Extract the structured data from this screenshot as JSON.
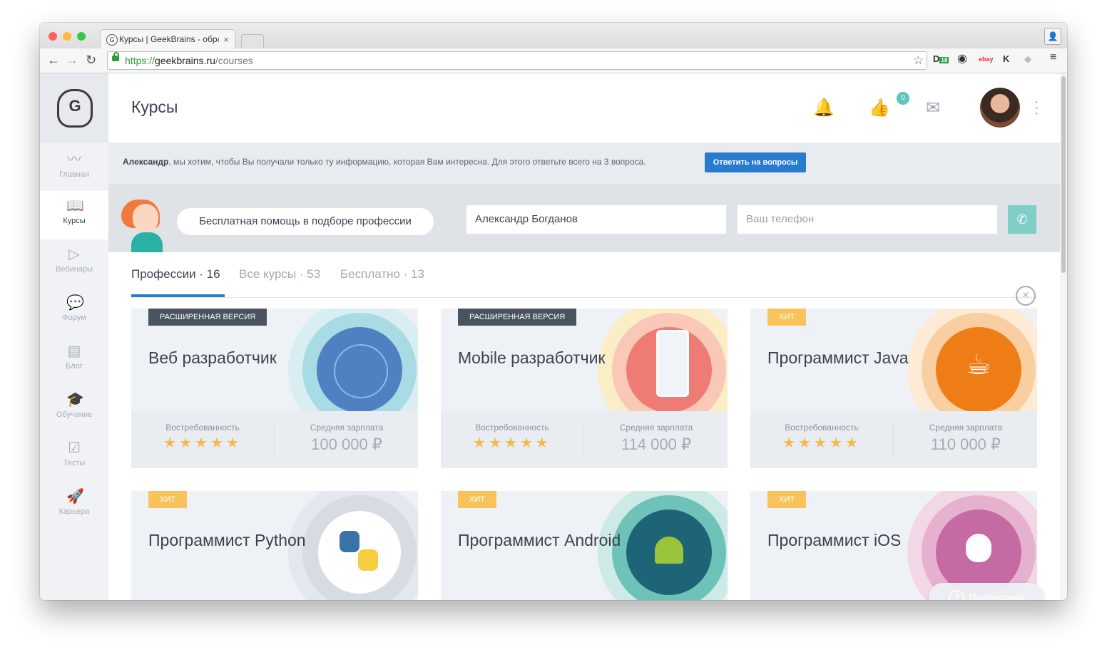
{
  "browser": {
    "tab_title": "Курсы | GeekBrains - обра",
    "url_scheme": "https://",
    "url_host": "geekbrains.ru",
    "url_path": "/courses",
    "ext_badge": "18"
  },
  "sidebar": {
    "items": [
      {
        "label": "Главная",
        "icon": "pulse-icon"
      },
      {
        "label": "Курсы",
        "icon": "book-icon"
      },
      {
        "label": "Вебинары",
        "icon": "play-icon"
      },
      {
        "label": "Форум",
        "icon": "chat-icon"
      },
      {
        "label": "Блог",
        "icon": "news-icon"
      },
      {
        "label": "Обучение",
        "icon": "graduation-cap-icon"
      },
      {
        "label": "Тесты",
        "icon": "checkbox-icon"
      },
      {
        "label": "Карьера",
        "icon": "rocket-icon"
      }
    ],
    "active_index": 1
  },
  "header": {
    "title": "Курсы",
    "likes_count": "0"
  },
  "notice": {
    "name": "Александр",
    "text": ", мы хотим, чтобы Вы получали только ту информацию, которая Вам интересна. Для этого ответьте всего на 3 вопроса.",
    "button": "Ответить на вопросы"
  },
  "help": {
    "bubble": "Бесплатная помощь в подборе профессии",
    "name_value": "Александр Богданов",
    "phone_placeholder": "Ваш телефон"
  },
  "tabs": [
    {
      "label": "Профессии · 16"
    },
    {
      "label": "Все курсы · 53"
    },
    {
      "label": "Бесплатно · 13"
    }
  ],
  "cards": [
    {
      "tag": "РАСШИРЕННАЯ ВЕРСИЯ",
      "title": "Веб разработчик",
      "demand_label": "Востребованность",
      "stars": "★★★★★",
      "salary_label": "Средняя зарплата",
      "salary": "100 000 ₽"
    },
    {
      "tag": "РАСШИРЕННАЯ ВЕРСИЯ",
      "title": "Mobile разработчик",
      "demand_label": "Востребованность",
      "stars": "★★★★★",
      "salary_label": "Средняя зарплата",
      "salary": "114 000 ₽"
    },
    {
      "tag": "ХИТ",
      "title": "Программист Java",
      "demand_label": "Востребованность",
      "stars": "★★★★★",
      "salary_label": "Средняя зарплата",
      "salary": "110 000 ₽"
    },
    {
      "tag": "ХИТ",
      "title": "Программист Python"
    },
    {
      "tag": "ХИТ",
      "title": "Программист Android"
    },
    {
      "tag": "ХИТ",
      "title": "Программист iOS"
    }
  ],
  "support": {
    "label": "Поддержка"
  },
  "colors": {
    "accent": "#2a7bd0",
    "teal": "#5fc5b8",
    "star": "#f5b94a",
    "hit_tag": "#f8c35a",
    "dark_tag": "#4a5360"
  }
}
